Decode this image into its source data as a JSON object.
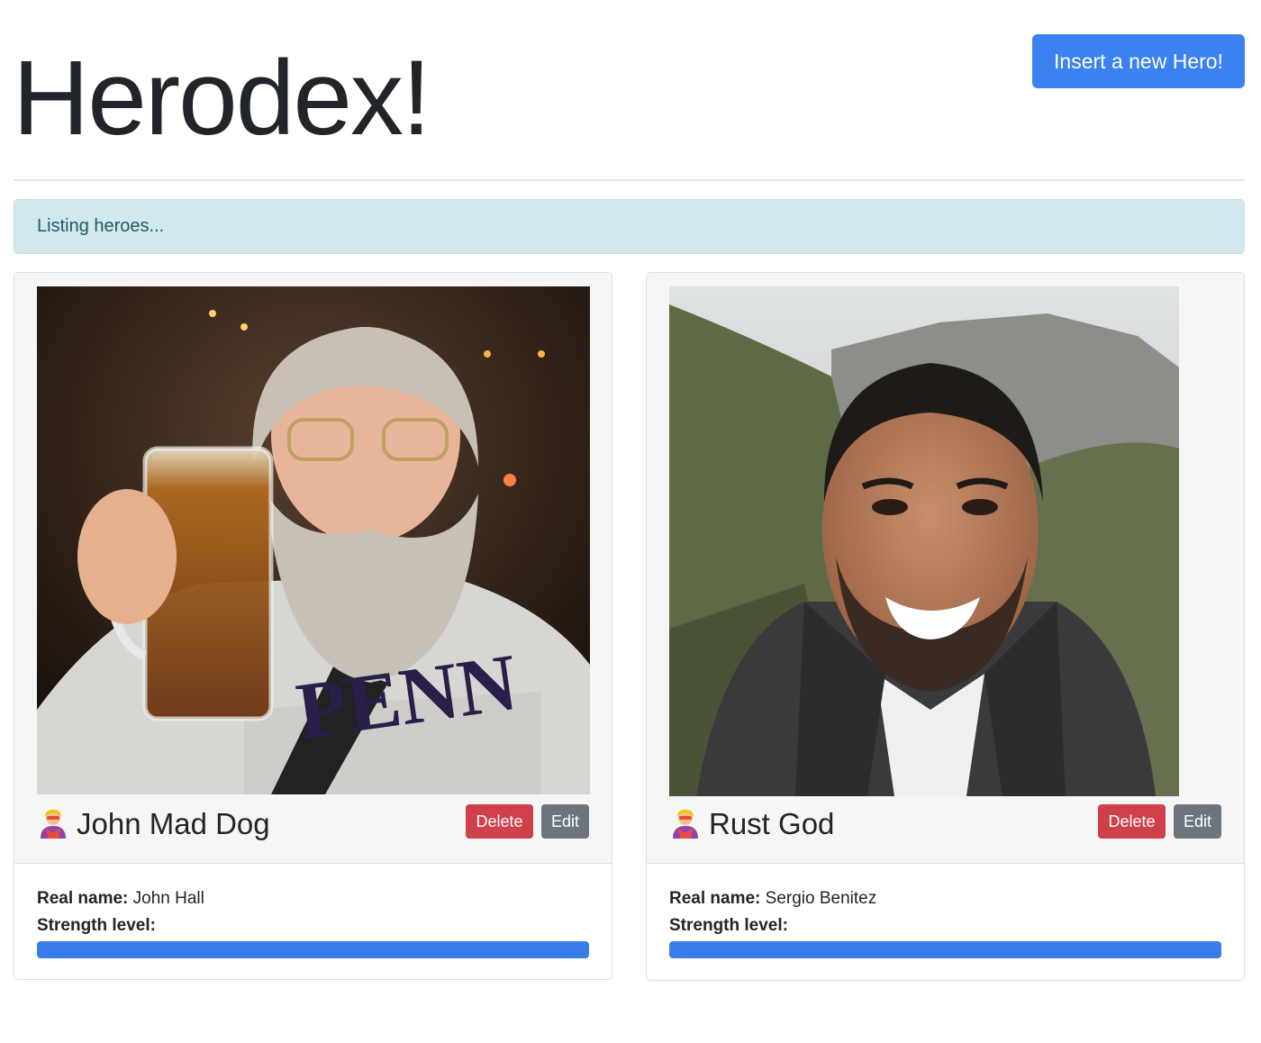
{
  "page": {
    "title": "Herodex!",
    "insert_button": "Insert a new Hero!"
  },
  "alert": {
    "text": "Listing heroes..."
  },
  "heroes": [
    {
      "name": "John Mad Dog",
      "emoji": "superhero-icon",
      "photo": "photo of bearded man holding a beer mug",
      "delete_label": "Delete",
      "edit_label": "Edit",
      "real_name_label": "Real name:",
      "real_name": "John Hall",
      "strength_label": "Strength level:",
      "strength_level": 1.0
    },
    {
      "name": "Rust God",
      "emoji": "superhero-icon",
      "photo": "photo of smiling man outdoors with mountains",
      "delete_label": "Delete",
      "edit_label": "Edit",
      "real_name_label": "Real name:",
      "real_name": "Sergio Benitez",
      "strength_label": "Strength level:",
      "strength_level": 1.0
    }
  ],
  "colors": {
    "primary": "#3b82f0",
    "danger": "#d0404a",
    "secondary": "#6c757d",
    "info_bg": "#d1e8ee",
    "info_text": "#225b67"
  }
}
